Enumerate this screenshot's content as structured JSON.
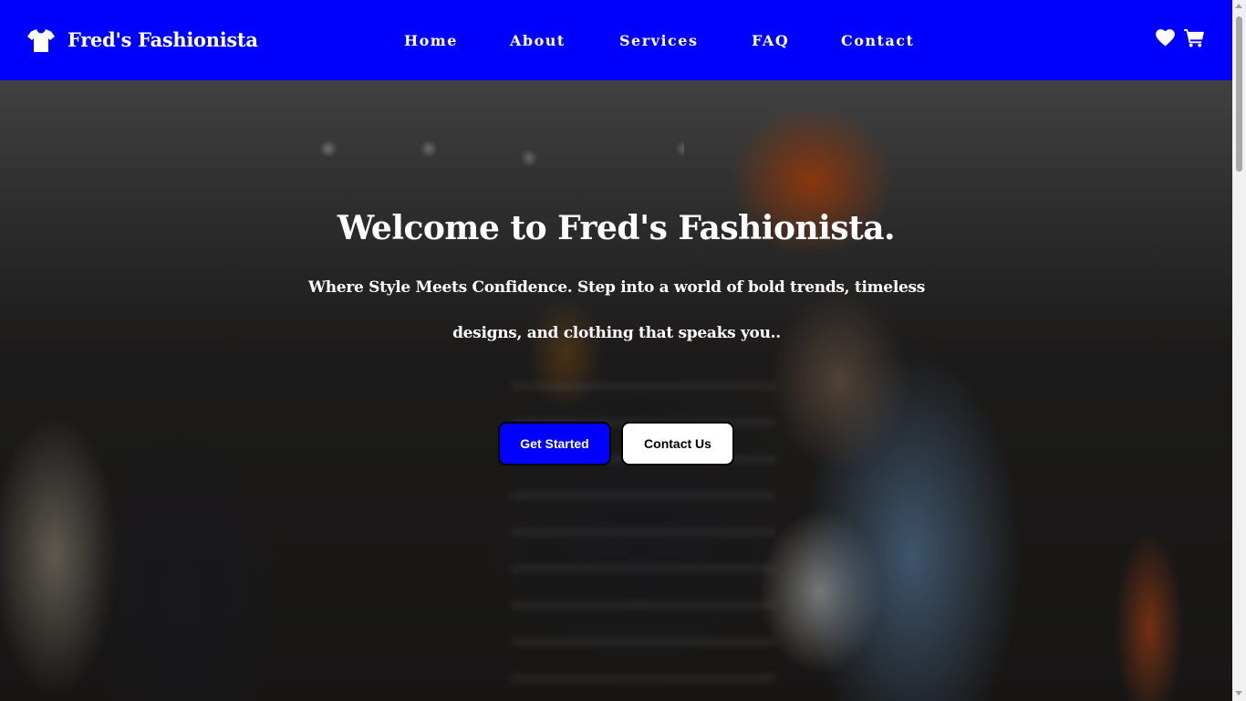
{
  "header": {
    "brand_name": "Fred's Fashionista",
    "brand_icon": "tshirt-icon",
    "nav": [
      {
        "label": "Home"
      },
      {
        "label": "About"
      },
      {
        "label": "Services"
      },
      {
        "label": "FAQ"
      },
      {
        "label": "Contact"
      }
    ],
    "icons": [
      "heart-icon",
      "cart-icon"
    ],
    "background_color": "#0000ff"
  },
  "hero": {
    "title": "Welcome to Fred's Fashionista.",
    "subtitle": "Where Style Meets Confidence. Step into a world of bold trends, timeless designs, and clothing that speaks you..",
    "primary_button": "Get Started",
    "secondary_button": "Contact Us",
    "primary_button_color": "#0000ff"
  }
}
